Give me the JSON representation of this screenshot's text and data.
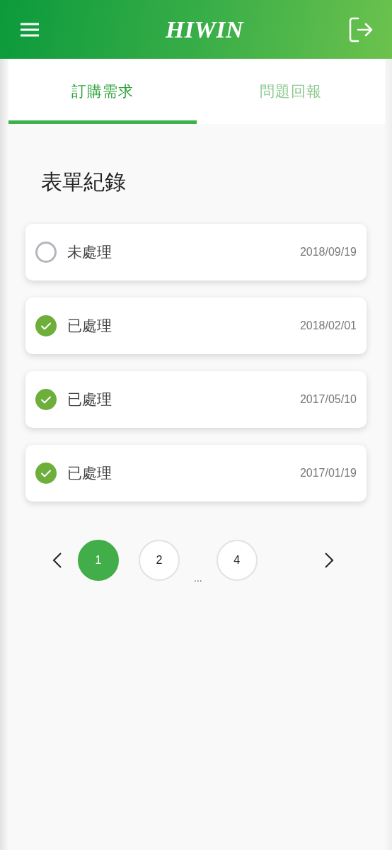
{
  "header": {
    "logo": "HIWIN"
  },
  "tabs": [
    {
      "label": "訂購需求",
      "selected": true
    },
    {
      "label": "問題回報",
      "selected": false
    }
  ],
  "section_title": "表單紀錄",
  "records": [
    {
      "status": "未處理",
      "checked": false,
      "date": "2018/09/19"
    },
    {
      "status": "已處理",
      "checked": true,
      "date": "2018/02/01"
    },
    {
      "status": "已處理",
      "checked": true,
      "date": "2017/05/10"
    },
    {
      "status": "已處理",
      "checked": true,
      "date": "2017/01/19"
    }
  ],
  "pagination": [
    {
      "kind": "page",
      "label": "1",
      "selected": true
    },
    {
      "kind": "page",
      "label": "2",
      "selected": false
    },
    {
      "kind": "ellipsis",
      "label": "..."
    },
    {
      "kind": "page",
      "label": "4",
      "selected": false
    }
  ]
}
